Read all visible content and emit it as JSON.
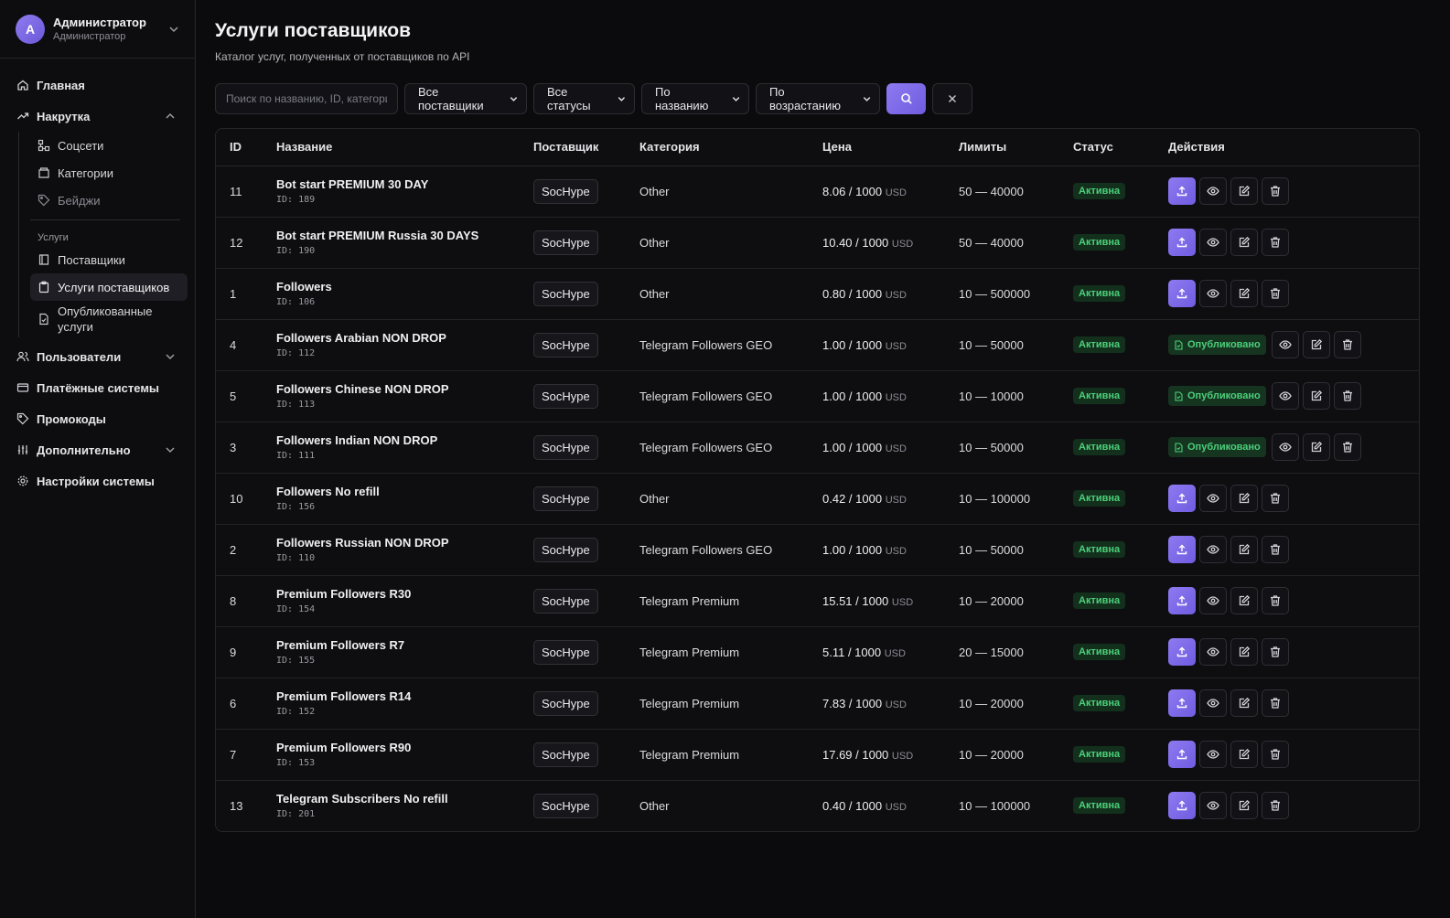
{
  "user": {
    "initial": "А",
    "name": "Администратор",
    "role": "Администратор"
  },
  "nav": {
    "home": "Главная",
    "boost": "Накрутка",
    "boost_sub": {
      "socials": "Соцсети",
      "categories": "Категории",
      "badges": "Бейджи"
    },
    "services_heading": "Услуги",
    "services_sub": {
      "suppliers": "Поставщики",
      "supplier_services": "Услуги поставщиков",
      "published": "Опубликованные услуги"
    },
    "users": "Пользователи",
    "payments": "Платёжные системы",
    "promo": "Промокоды",
    "extra": "Дополнительно",
    "settings": "Настройки системы"
  },
  "page": {
    "title": "Услуги поставщиков",
    "subtitle": "Каталог услуг, полученных от поставщиков по API"
  },
  "filters": {
    "search_placeholder": "Поиск по названию, ID, категории",
    "supplier": "Все поставщики",
    "status": "Все статусы",
    "sort_field": "По названию",
    "sort_order": "По возрастанию"
  },
  "table": {
    "headers": {
      "id": "ID",
      "name": "Название",
      "supplier": "Поставщик",
      "category": "Категория",
      "price": "Цена",
      "limits": "Лимиты",
      "status": "Статус",
      "actions": "Действия"
    },
    "currency": "USD",
    "published_label": "Опубликовано",
    "rows": [
      {
        "id": "11",
        "name": "Bot start PREMIUM 30 DAY",
        "sub_id": "ID: 189",
        "supplier": "SocHype",
        "category": "Other",
        "price": "8.06 / 1000",
        "limits": "50 — 40000",
        "status": "Активна",
        "published": false
      },
      {
        "id": "12",
        "name": "Bot start PREMIUM Russia 30 DAYS",
        "sub_id": "ID: 190",
        "supplier": "SocHype",
        "category": "Other",
        "price": "10.40 / 1000",
        "limits": "50 — 40000",
        "status": "Активна",
        "published": false
      },
      {
        "id": "1",
        "name": "Followers",
        "sub_id": "ID: 106",
        "supplier": "SocHype",
        "category": "Other",
        "price": "0.80 / 1000",
        "limits": "10 — 500000",
        "status": "Активна",
        "published": false
      },
      {
        "id": "4",
        "name": "Followers Arabian NON DROP",
        "sub_id": "ID: 112",
        "supplier": "SocHype",
        "category": "Telegram Followers GEO",
        "price": "1.00 / 1000",
        "limits": "10 — 50000",
        "status": "Активна",
        "published": true
      },
      {
        "id": "5",
        "name": "Followers Chinese NON DROP",
        "sub_id": "ID: 113",
        "supplier": "SocHype",
        "category": "Telegram Followers GEO",
        "price": "1.00 / 1000",
        "limits": "10 — 10000",
        "status": "Активна",
        "published": true
      },
      {
        "id": "3",
        "name": "Followers Indian NON DROP",
        "sub_id": "ID: 111",
        "supplier": "SocHype",
        "category": "Telegram Followers GEO",
        "price": "1.00 / 1000",
        "limits": "10 — 50000",
        "status": "Активна",
        "published": true
      },
      {
        "id": "10",
        "name": "Followers No refill",
        "sub_id": "ID: 156",
        "supplier": "SocHype",
        "category": "Other",
        "price": "0.42 / 1000",
        "limits": "10 — 100000",
        "status": "Активна",
        "published": false
      },
      {
        "id": "2",
        "name": "Followers Russian NON DROP",
        "sub_id": "ID: 110",
        "supplier": "SocHype",
        "category": "Telegram Followers GEO",
        "price": "1.00 / 1000",
        "limits": "10 — 50000",
        "status": "Активна",
        "published": false
      },
      {
        "id": "8",
        "name": "Premium Followers R30",
        "sub_id": "ID: 154",
        "supplier": "SocHype",
        "category": "Telegram Premium",
        "price": "15.51 / 1000",
        "limits": "10 — 20000",
        "status": "Активна",
        "published": false
      },
      {
        "id": "9",
        "name": "Premium Followers R7",
        "sub_id": "ID: 155",
        "supplier": "SocHype",
        "category": "Telegram Premium",
        "price": "5.11 / 1000",
        "limits": "20 — 15000",
        "status": "Активна",
        "published": false
      },
      {
        "id": "6",
        "name": "Premium Followers R14",
        "sub_id": "ID: 152",
        "supplier": "SocHype",
        "category": "Telegram Premium",
        "price": "7.83 / 1000",
        "limits": "10 — 20000",
        "status": "Активна",
        "published": false
      },
      {
        "id": "7",
        "name": "Premium Followers R90",
        "sub_id": "ID: 153",
        "supplier": "SocHype",
        "category": "Telegram Premium",
        "price": "17.69 / 1000",
        "limits": "10 — 20000",
        "status": "Активна",
        "published": false
      },
      {
        "id": "13",
        "name": "Telegram Subscribers No refill",
        "sub_id": "ID: 201",
        "supplier": "SocHype",
        "category": "Other",
        "price": "0.40 / 1000",
        "limits": "10 — 100000",
        "status": "Активна",
        "published": false
      }
    ]
  },
  "colors": {
    "accent": "#7c68e8",
    "active_badge": "#4cd07a",
    "background": "#0b0b0d"
  }
}
